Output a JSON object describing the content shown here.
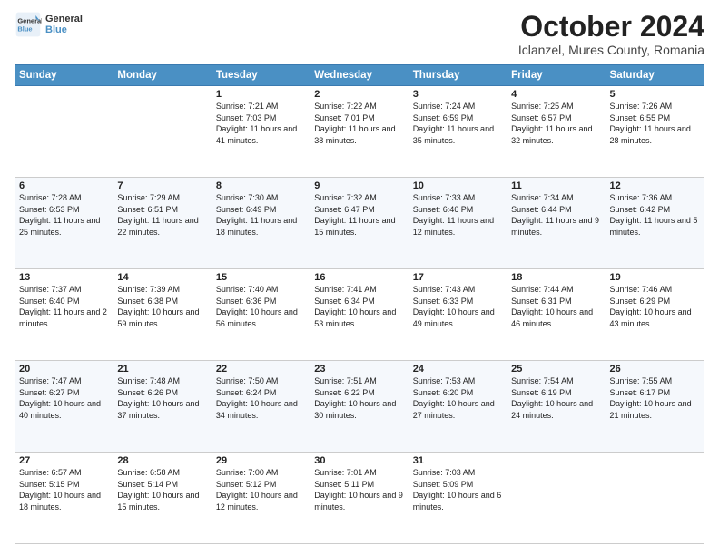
{
  "header": {
    "logo_line1": "General",
    "logo_line2": "Blue",
    "title": "October 2024",
    "subtitle": "Iclanzel, Mures County, Romania"
  },
  "columns": [
    "Sunday",
    "Monday",
    "Tuesday",
    "Wednesday",
    "Thursday",
    "Friday",
    "Saturday"
  ],
  "rows": [
    [
      {
        "num": "",
        "info": ""
      },
      {
        "num": "",
        "info": ""
      },
      {
        "num": "1",
        "info": "Sunrise: 7:21 AM\nSunset: 7:03 PM\nDaylight: 11 hours and 41 minutes."
      },
      {
        "num": "2",
        "info": "Sunrise: 7:22 AM\nSunset: 7:01 PM\nDaylight: 11 hours and 38 minutes."
      },
      {
        "num": "3",
        "info": "Sunrise: 7:24 AM\nSunset: 6:59 PM\nDaylight: 11 hours and 35 minutes."
      },
      {
        "num": "4",
        "info": "Sunrise: 7:25 AM\nSunset: 6:57 PM\nDaylight: 11 hours and 32 minutes."
      },
      {
        "num": "5",
        "info": "Sunrise: 7:26 AM\nSunset: 6:55 PM\nDaylight: 11 hours and 28 minutes."
      }
    ],
    [
      {
        "num": "6",
        "info": "Sunrise: 7:28 AM\nSunset: 6:53 PM\nDaylight: 11 hours and 25 minutes."
      },
      {
        "num": "7",
        "info": "Sunrise: 7:29 AM\nSunset: 6:51 PM\nDaylight: 11 hours and 22 minutes."
      },
      {
        "num": "8",
        "info": "Sunrise: 7:30 AM\nSunset: 6:49 PM\nDaylight: 11 hours and 18 minutes."
      },
      {
        "num": "9",
        "info": "Sunrise: 7:32 AM\nSunset: 6:47 PM\nDaylight: 11 hours and 15 minutes."
      },
      {
        "num": "10",
        "info": "Sunrise: 7:33 AM\nSunset: 6:46 PM\nDaylight: 11 hours and 12 minutes."
      },
      {
        "num": "11",
        "info": "Sunrise: 7:34 AM\nSunset: 6:44 PM\nDaylight: 11 hours and 9 minutes."
      },
      {
        "num": "12",
        "info": "Sunrise: 7:36 AM\nSunset: 6:42 PM\nDaylight: 11 hours and 5 minutes."
      }
    ],
    [
      {
        "num": "13",
        "info": "Sunrise: 7:37 AM\nSunset: 6:40 PM\nDaylight: 11 hours and 2 minutes."
      },
      {
        "num": "14",
        "info": "Sunrise: 7:39 AM\nSunset: 6:38 PM\nDaylight: 10 hours and 59 minutes."
      },
      {
        "num": "15",
        "info": "Sunrise: 7:40 AM\nSunset: 6:36 PM\nDaylight: 10 hours and 56 minutes."
      },
      {
        "num": "16",
        "info": "Sunrise: 7:41 AM\nSunset: 6:34 PM\nDaylight: 10 hours and 53 minutes."
      },
      {
        "num": "17",
        "info": "Sunrise: 7:43 AM\nSunset: 6:33 PM\nDaylight: 10 hours and 49 minutes."
      },
      {
        "num": "18",
        "info": "Sunrise: 7:44 AM\nSunset: 6:31 PM\nDaylight: 10 hours and 46 minutes."
      },
      {
        "num": "19",
        "info": "Sunrise: 7:46 AM\nSunset: 6:29 PM\nDaylight: 10 hours and 43 minutes."
      }
    ],
    [
      {
        "num": "20",
        "info": "Sunrise: 7:47 AM\nSunset: 6:27 PM\nDaylight: 10 hours and 40 minutes."
      },
      {
        "num": "21",
        "info": "Sunrise: 7:48 AM\nSunset: 6:26 PM\nDaylight: 10 hours and 37 minutes."
      },
      {
        "num": "22",
        "info": "Sunrise: 7:50 AM\nSunset: 6:24 PM\nDaylight: 10 hours and 34 minutes."
      },
      {
        "num": "23",
        "info": "Sunrise: 7:51 AM\nSunset: 6:22 PM\nDaylight: 10 hours and 30 minutes."
      },
      {
        "num": "24",
        "info": "Sunrise: 7:53 AM\nSunset: 6:20 PM\nDaylight: 10 hours and 27 minutes."
      },
      {
        "num": "25",
        "info": "Sunrise: 7:54 AM\nSunset: 6:19 PM\nDaylight: 10 hours and 24 minutes."
      },
      {
        "num": "26",
        "info": "Sunrise: 7:55 AM\nSunset: 6:17 PM\nDaylight: 10 hours and 21 minutes."
      }
    ],
    [
      {
        "num": "27",
        "info": "Sunrise: 6:57 AM\nSunset: 5:15 PM\nDaylight: 10 hours and 18 minutes."
      },
      {
        "num": "28",
        "info": "Sunrise: 6:58 AM\nSunset: 5:14 PM\nDaylight: 10 hours and 15 minutes."
      },
      {
        "num": "29",
        "info": "Sunrise: 7:00 AM\nSunset: 5:12 PM\nDaylight: 10 hours and 12 minutes."
      },
      {
        "num": "30",
        "info": "Sunrise: 7:01 AM\nSunset: 5:11 PM\nDaylight: 10 hours and 9 minutes."
      },
      {
        "num": "31",
        "info": "Sunrise: 7:03 AM\nSunset: 5:09 PM\nDaylight: 10 hours and 6 minutes."
      },
      {
        "num": "",
        "info": ""
      },
      {
        "num": "",
        "info": ""
      }
    ]
  ]
}
